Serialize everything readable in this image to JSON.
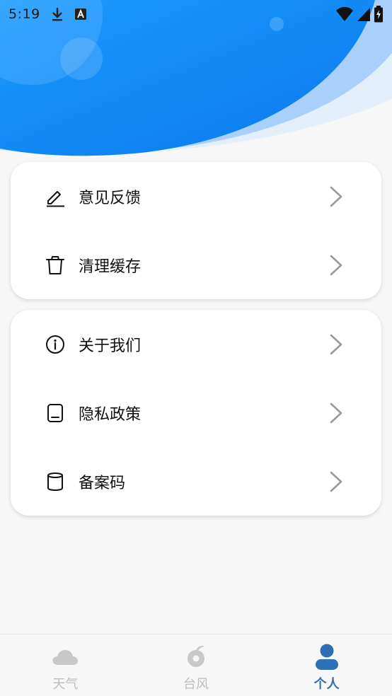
{
  "status_bar": {
    "time": "5:19",
    "icons_left": [
      "download-icon",
      "a-icon"
    ],
    "icons_right": [
      "wifi-icon",
      "cell-signal-icon",
      "battery-charging-icon"
    ]
  },
  "menu_groups": [
    {
      "items": [
        {
          "label": "意见反馈",
          "icon": "pencil-icon"
        },
        {
          "label": "清理缓存",
          "icon": "trash-icon"
        }
      ]
    },
    {
      "items": [
        {
          "label": "关于我们",
          "icon": "info-icon"
        },
        {
          "label": "隐私政策",
          "icon": "document-icon"
        },
        {
          "label": "备案码",
          "icon": "cylinder-icon"
        }
      ]
    }
  ],
  "bottom_nav": {
    "tabs": [
      {
        "label": "天气",
        "icon": "cloud-icon",
        "active": false
      },
      {
        "label": "台风",
        "icon": "typhoon-icon",
        "active": false
      },
      {
        "label": "个人",
        "icon": "person-icon",
        "active": true
      }
    ]
  },
  "colors": {
    "header_blue": "#0a84f5",
    "active_tab": "#2f6fb5",
    "inactive_tab": "#bdbdbd"
  }
}
